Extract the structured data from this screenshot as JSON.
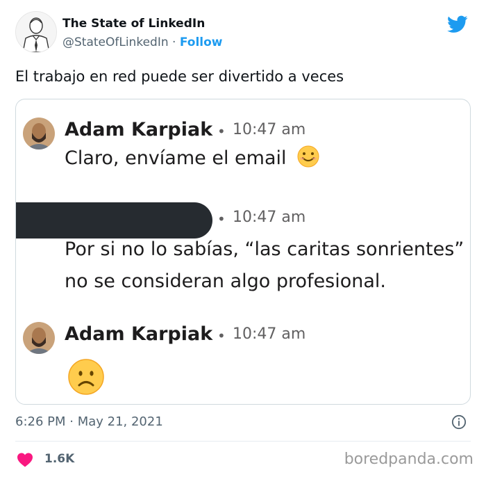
{
  "tweet": {
    "author_name": "The State of LinkedIn",
    "handle": "@StateOfLinkedIn",
    "separator": "·",
    "follow_label": "Follow",
    "text": "El trabajo en red puede ser divertido a veces",
    "time": "6:26 PM · May 21, 2021",
    "likes": "1.6K",
    "brand_color": "#1d9bf0",
    "like_color": "#f91880"
  },
  "chat": {
    "messages": [
      {
        "sender": "Adam Karpiak",
        "dot": "•",
        "time": "10:47 am",
        "text": "Claro, envíame el email",
        "emoji": "smiling-face-icon"
      },
      {
        "sender": "",
        "dot": "•",
        "time": "10:47 am",
        "text_line1": "Por si no lo sabías, “las caritas sonrientes”",
        "text_line2": "no se consideran algo profesional."
      },
      {
        "sender": "Adam Karpiak",
        "dot": "•",
        "time": "10:47 am",
        "emoji": "frowning-face-icon"
      }
    ]
  },
  "watermark": "boredpanda.com"
}
